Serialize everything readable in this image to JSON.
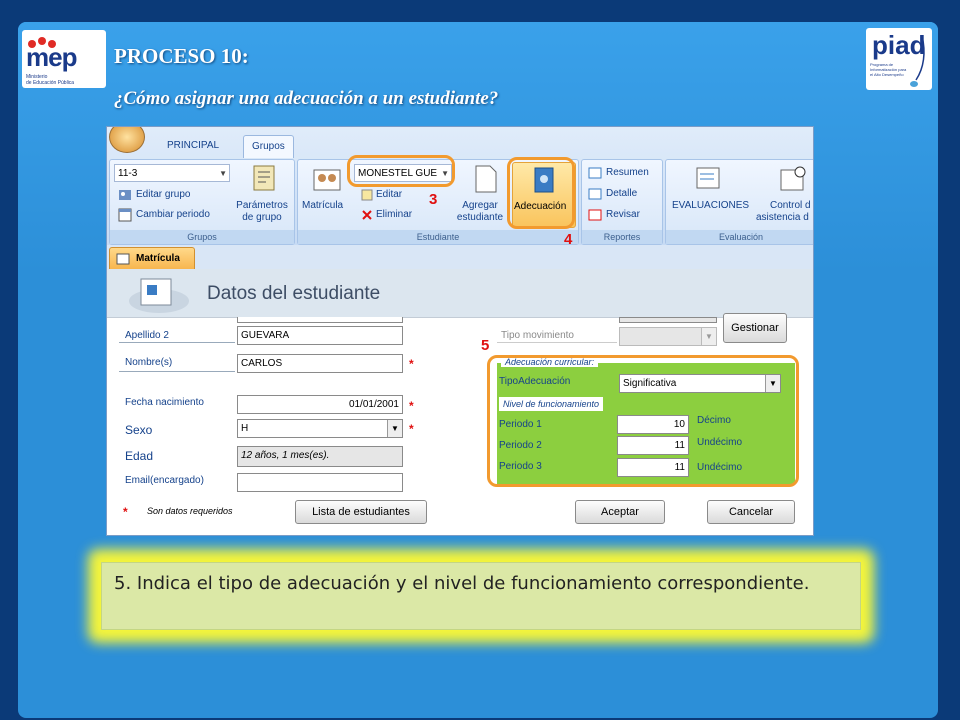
{
  "slide": {
    "title": "PROCESO 10:",
    "subtitle": "¿Cómo asignar una adecuación a un estudiante?",
    "caption": "5. Indica el tipo de adecuación y el nivel de funcionamiento correspondiente."
  },
  "logos": {
    "mep_text": "mep",
    "mep_sub1": "Ministerio",
    "mep_sub2": "de Educación Pública",
    "piad_text": "piad",
    "piad_sub": "Programa de Informatización para el Alto Desempeño"
  },
  "ribbon": {
    "tabs": [
      "PRINCIPAL",
      "Grupos"
    ],
    "groups": {
      "grupos": {
        "label": "Grupos",
        "group_select": "11-3",
        "edit_group": "Editar grupo",
        "change_period": "Cambiar periodo",
        "params_line1": "Parámetros",
        "params_line2": "de grupo"
      },
      "estudiante": {
        "label": "Estudiante",
        "matricula": "Matrícula",
        "student_select": "MONESTEL GUE",
        "edit": "Editar",
        "delete": "Eliminar",
        "add_line1": "Agregar",
        "add_line2": "estudiante",
        "adecuacion": "Adecuación"
      },
      "reportes": {
        "label": "Reportes",
        "resumen": "Resumen",
        "detalle": "Detalle",
        "revisar": "Revisar"
      },
      "evaluacion": {
        "label": "Evaluación",
        "evaluaciones": "EVALUACIONES",
        "control_line1": "Control d",
        "control_line2": "asistencia d"
      }
    }
  },
  "doc_tab": "Matrícula",
  "form": {
    "title": "Datos del estudiante",
    "apellido2_label": "Apellido 2",
    "apellido2_value": "GUEVARA",
    "nombre_label": "Nombre(s)",
    "nombre_value": "CARLOS",
    "fecha_label": "Fecha nacimiento",
    "fecha_value": "01/01/2001",
    "sexo_label": "Sexo",
    "sexo_value": "H",
    "edad_label": "Edad",
    "edad_value": "12 años, 1 mes(es).",
    "email_label": "Email(encargado)",
    "email_value": "",
    "required_note": "Son datos requeridos",
    "tipo_mov_label": "Tipo movimiento",
    "gestionar": "Gestionar",
    "star": "*",
    "adecuacion": {
      "heading": "Adecuación curricular:",
      "tipo_label": "TipoAdecuación",
      "tipo_value": "Significativa",
      "nivel_heading": "Nivel de funcionamiento",
      "periods": [
        {
          "label": "Periodo 1",
          "value": "10",
          "level": "Décimo"
        },
        {
          "label": "Periodo 2",
          "value": "11",
          "level": "Undécimo"
        },
        {
          "label": "Periodo 3",
          "value": "11",
          "level": "Undécimo"
        }
      ]
    },
    "buttons": {
      "lista": "Lista de estudiantes",
      "aceptar": "Aceptar",
      "cancelar": "Cancelar"
    }
  },
  "callouts": {
    "c3": "3",
    "c4": "4",
    "c5": "5"
  },
  "colors": {
    "callout_border": "#f29a2e",
    "callout_number": "#e01010",
    "adecuacion_panel": "#8ccf3f"
  }
}
